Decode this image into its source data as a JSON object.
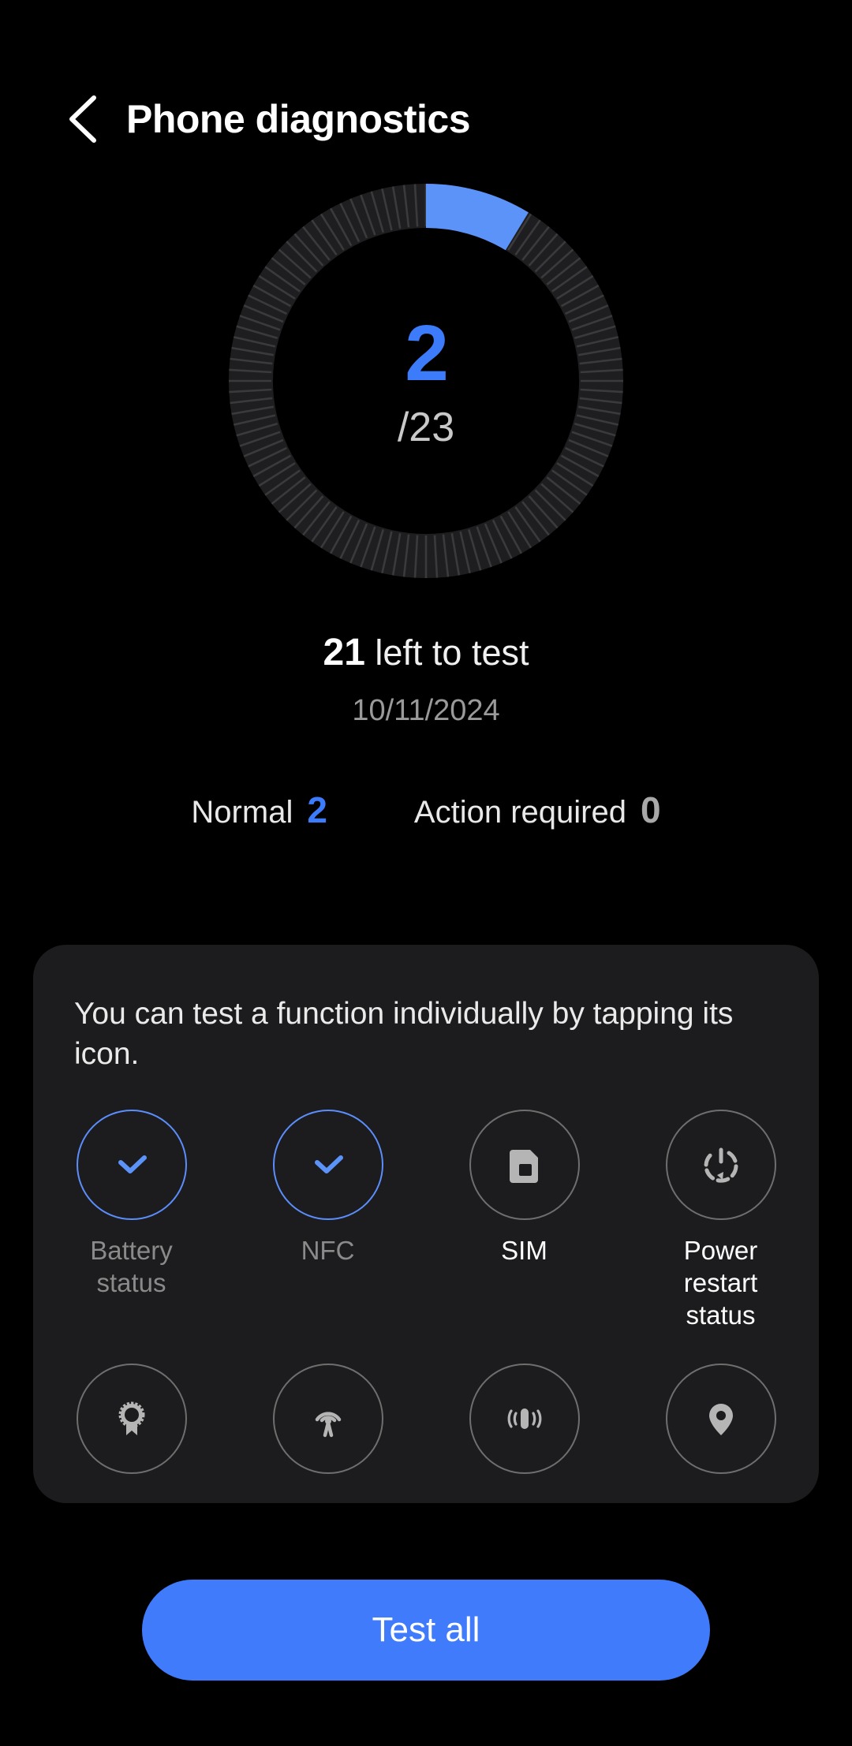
{
  "header": {
    "back_icon": "chevron-left-icon",
    "title": "Phone diagnostics"
  },
  "progress": {
    "tested": "2",
    "total_label": "/23",
    "total": 23,
    "remaining_count": "21",
    "remaining_text": " left to test",
    "date": "10/11/2024",
    "accent_color": "#3C7BFA",
    "track_color": "#252527"
  },
  "stats": {
    "normal_label": "Normal",
    "normal_value": "2",
    "action_label": "Action required",
    "action_value": "0"
  },
  "card": {
    "description": "You can test a function individually by tapping its icon.",
    "items": [
      {
        "label": "Battery status",
        "icon": "check-icon",
        "state": "done"
      },
      {
        "label": "NFC",
        "icon": "check-icon",
        "state": "done"
      },
      {
        "label": "SIM",
        "icon": "sim-card-icon",
        "state": "untested"
      },
      {
        "label": "Power restart status",
        "icon": "power-restart-icon",
        "state": "untested"
      },
      {
        "label": "",
        "icon": "certificate-badge-icon",
        "state": "untested"
      },
      {
        "label": "",
        "icon": "broadcast-antenna-icon",
        "state": "untested"
      },
      {
        "label": "",
        "icon": "vibration-icon",
        "state": "untested"
      },
      {
        "label": "",
        "icon": "location-pin-icon",
        "state": "untested"
      }
    ]
  },
  "footer": {
    "test_all_label": "Test all",
    "button_color": "#3F7BFA"
  }
}
